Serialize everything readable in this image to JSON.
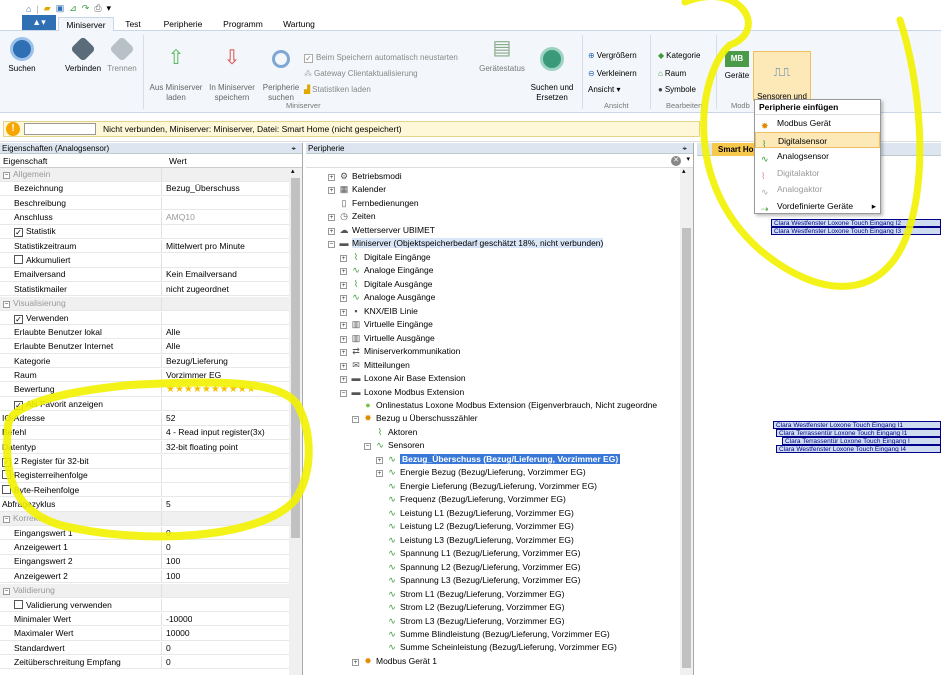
{
  "qat": {
    "icons": [
      "home-icon",
      "separator-icon",
      "folder-open-icon",
      "save-icon",
      "chart-icon",
      "redo-icon",
      "print-icon",
      "dropdown-icon"
    ]
  },
  "tabs": {
    "file": "▲▾",
    "items": [
      "Miniserver",
      "Test",
      "Peripherie",
      "Programm",
      "Wartung"
    ],
    "active": "Miniserver"
  },
  "ribbon": {
    "buttons": [
      {
        "label": "Suchen"
      },
      {
        "label": "Verbinden"
      },
      {
        "label": "Trennen"
      },
      {
        "label": "Aus Miniserver\nladen"
      },
      {
        "label": "In Miniserver\nspeichern"
      },
      {
        "label": "Peripherie\nsuchen"
      },
      {
        "label": "Gerätestatus"
      },
      {
        "label": "Suchen und\nErsetzen"
      },
      {
        "label": "Geräte"
      }
    ],
    "options": {
      "autostart": "Beim Speichern automatisch neustarten",
      "gateway": "Gateway Clientaktualisierung",
      "stats": "Statistiken laden"
    },
    "view": {
      "zoomin": "Vergrößern",
      "zoomout": "Verkleinern",
      "view": "Ansicht ▾",
      "category": "Kategorie",
      "room": "Raum",
      "symbols": "Symbole"
    },
    "groups": {
      "miniserver": "Miniserver",
      "ansicht": "Ansicht",
      "bearbeiten": "Bearbeiten",
      "modb": "Modb"
    },
    "mb_label": "MB",
    "sensors_button": "Sensoren und\nAktoren ▾"
  },
  "dropdown": {
    "title": "Peripherie einfügen",
    "items": [
      {
        "label": "Modbus Gerät",
        "dim": false
      },
      {
        "label": "Digitalsensor",
        "dim": false,
        "hl": true
      },
      {
        "label": "Analogsensor",
        "dim": false
      },
      {
        "label": "Digitalaktor",
        "dim": true
      },
      {
        "label": "Analogaktor",
        "dim": true
      },
      {
        "label": "Vordefinierte Geräte",
        "dim": false,
        "submenu": true
      }
    ]
  },
  "infobar": {
    "text": "Nicht verbunden, Miniserver: Miniserver, Datei: Smart Home (nicht gespeichert)"
  },
  "props": {
    "title": "Eigenschaften (Analogsensor)",
    "col_name": "Eigenschaft",
    "col_value": "Wert",
    "rows": [
      {
        "n": "Allgemein",
        "v": "",
        "cat": true
      },
      {
        "n": "Bezeichnung",
        "v": "Bezug_Überschuss"
      },
      {
        "n": "Beschreibung",
        "v": ""
      },
      {
        "n": "Anschluss",
        "v": "AMQ10",
        "dimv": true
      },
      {
        "n": "Statistik",
        "v": "",
        "cb": "checked"
      },
      {
        "n": "Statistikzeitraum",
        "v": "Mittelwert pro Minute"
      },
      {
        "n": "Akkumuliert",
        "v": "",
        "cb": "unchecked"
      },
      {
        "n": "Emailversand",
        "v": "Kein Emailversand"
      },
      {
        "n": "Statistikmailer",
        "v": "nicht zugeordnet"
      },
      {
        "n": "Visualisierung",
        "v": "",
        "cat": true
      },
      {
        "n": "Verwenden",
        "v": "",
        "cb": "checked"
      },
      {
        "n": "Erlaubte Benutzer lokal",
        "v": "Alle"
      },
      {
        "n": "Erlaubte Benutzer Internet",
        "v": "Alle"
      },
      {
        "n": "Kategorie",
        "v": "Bezug/Lieferung"
      },
      {
        "n": "Raum",
        "v": "Vorzimmer EG"
      },
      {
        "n": "Bewertung",
        "v": "★★★★★★★★★★",
        "stars": true
      },
      {
        "n": "Als Favorit anzeigen",
        "v": "",
        "cb": "checked"
      },
      {
        "n": "IO-Adresse",
        "v": "52",
        "flush": true
      },
      {
        "n": "Befehl",
        "v": "4 - Read input register(3x)",
        "flush": true
      },
      {
        "n": "Datentyp",
        "v": "32-bit floating point",
        "flush": true
      },
      {
        "n": "2 Register für 32-bit",
        "v": "",
        "cb": "checked",
        "flush": true
      },
      {
        "n": "Registerreihenfolge",
        "v": "",
        "cb": "unchecked",
        "flush": true
      },
      {
        "n": "Byte-Reihenfolge",
        "v": "",
        "cb": "unchecked",
        "flush": true
      },
      {
        "n": "Abfragezyklus",
        "v": "5",
        "flush": true
      },
      {
        "n": "Korrektur",
        "v": "",
        "cat": true
      },
      {
        "n": "Eingangswert 1",
        "v": "0"
      },
      {
        "n": "Anzeigewert 1",
        "v": "0"
      },
      {
        "n": "Eingangswert 2",
        "v": "100"
      },
      {
        "n": "Anzeigewert 2",
        "v": "100"
      },
      {
        "n": "Validierung",
        "v": "",
        "cat": true
      },
      {
        "n": "Validierung verwenden",
        "v": "",
        "cb": "unchecked"
      },
      {
        "n": "Minimaler Wert",
        "v": "-10000"
      },
      {
        "n": "Maximaler Wert",
        "v": "10000"
      },
      {
        "n": "Standardwert",
        "v": "0"
      },
      {
        "n": "Zeitüberschreitung Empfang",
        "v": "0"
      }
    ]
  },
  "peri": {
    "title": "Peripherie",
    "tree": [
      {
        "l": "Betriebsmodi",
        "d": 0,
        "e": "+",
        "i": "⚙"
      },
      {
        "l": "Kalender",
        "d": 0,
        "e": "+",
        "i": "▦"
      },
      {
        "l": "Fernbedienungen",
        "d": 0,
        "e": "",
        "i": "▯"
      },
      {
        "l": "Zeiten",
        "d": 0,
        "e": "+",
        "i": "◷"
      },
      {
        "l": "Wetterserver UBIMET",
        "d": 0,
        "e": "+",
        "i": "☁"
      },
      {
        "l": "Miniserver (Objektspeicherbedarf geschätzt 18%, nicht verbunden)",
        "d": 0,
        "e": "−",
        "i": "▬",
        "hl": true
      },
      {
        "l": "Digitale Eingänge",
        "d": 1,
        "e": "+",
        "i": "⌇"
      },
      {
        "l": "Analoge Eingänge",
        "d": 1,
        "e": "+",
        "i": "∿"
      },
      {
        "l": "Digitale Ausgänge",
        "d": 1,
        "e": "+",
        "i": "⌇"
      },
      {
        "l": "Analoge Ausgänge",
        "d": 1,
        "e": "+",
        "i": "∿"
      },
      {
        "l": "KNX/EIB Linie",
        "d": 1,
        "e": "+",
        "i": "▪"
      },
      {
        "l": "Virtuelle Eingänge",
        "d": 1,
        "e": "+",
        "i": "▥"
      },
      {
        "l": "Virtuelle Ausgänge",
        "d": 1,
        "e": "+",
        "i": "▥"
      },
      {
        "l": "Miniserverkommunikation",
        "d": 1,
        "e": "+",
        "i": "⇄"
      },
      {
        "l": "Mitteilungen",
        "d": 1,
        "e": "+",
        "i": "✉"
      },
      {
        "l": "Loxone Air Base Extension",
        "d": 1,
        "e": "+",
        "i": "▬"
      },
      {
        "l": "Loxone Modbus Extension",
        "d": 1,
        "e": "−",
        "i": "▬"
      },
      {
        "l": "Onlinestatus Loxone Modbus Extension (Eigenverbrauch, Nicht zugeordne",
        "d": 2,
        "e": "",
        "i": "●"
      },
      {
        "l": "Bezug u Überschusszähler",
        "d": 2,
        "e": "−",
        "i": "✸"
      },
      {
        "l": "Aktoren",
        "d": 3,
        "e": "",
        "i": "⌇"
      },
      {
        "l": "Sensoren",
        "d": 3,
        "e": "−",
        "i": "∿"
      },
      {
        "l": "Bezug_Überschuss (Bezug/Lieferung, Vorzimmer EG)",
        "d": 4,
        "e": "+",
        "i": "∿",
        "sel": true
      },
      {
        "l": "Energie Bezug (Bezug/Lieferung, Vorzimmer EG)",
        "d": 4,
        "e": "+",
        "i": "∿"
      },
      {
        "l": "Energie Lieferung (Bezug/Lieferung, Vorzimmer EG)",
        "d": 4,
        "e": "",
        "i": "∿"
      },
      {
        "l": "Frequenz (Bezug/Lieferung, Vorzimmer EG)",
        "d": 4,
        "e": "",
        "i": "∿"
      },
      {
        "l": "Leistung L1 (Bezug/Lieferung, Vorzimmer EG)",
        "d": 4,
        "e": "",
        "i": "∿"
      },
      {
        "l": "Leistung L2 (Bezug/Lieferung, Vorzimmer EG)",
        "d": 4,
        "e": "",
        "i": "∿"
      },
      {
        "l": "Leistung L3 (Bezug/Lieferung, Vorzimmer EG)",
        "d": 4,
        "e": "",
        "i": "∿"
      },
      {
        "l": "Spannung L1 (Bezug/Lieferung, Vorzimmer EG)",
        "d": 4,
        "e": "",
        "i": "∿"
      },
      {
        "l": "Spannung L2 (Bezug/Lieferung, Vorzimmer EG)",
        "d": 4,
        "e": "",
        "i": "∿"
      },
      {
        "l": "Spannung L3 (Bezug/Lieferung, Vorzimmer EG)",
        "d": 4,
        "e": "",
        "i": "∿"
      },
      {
        "l": "Strom L1 (Bezug/Lieferung, Vorzimmer EG)",
        "d": 4,
        "e": "",
        "i": "∿"
      },
      {
        "l": "Strom L2 (Bezug/Lieferung, Vorzimmer EG)",
        "d": 4,
        "e": "",
        "i": "∿"
      },
      {
        "l": "Strom L3 (Bezug/Lieferung, Vorzimmer EG)",
        "d": 4,
        "e": "",
        "i": "∿"
      },
      {
        "l": "Summe Blindleistung (Bezug/Lieferung, Vorzimmer EG)",
        "d": 4,
        "e": "",
        "i": "∿"
      },
      {
        "l": "Summe Scheinleistung (Bezug/Lieferung, Vorzimmer EG)",
        "d": 4,
        "e": "",
        "i": "∿"
      },
      {
        "l": "Modbus Gerät 1",
        "d": 2,
        "e": "+",
        "i": "✸"
      }
    ]
  },
  "canvas": {
    "tab": "Smart Home",
    "blocks_top": [
      "Clara Westfenster Loxone Touch Eingang I2",
      "Clara Westfenster Loxone Touch Eingang I3"
    ],
    "blocks_mid": [
      "Clara Westfenster Loxone Touch Eingang I1",
      "Clara Terrassentür Loxone Touch Eingang I1",
      "Clara Terrassentür Loxone Touch Eingang I",
      "Clara Westfenster Loxone Touch Eingang I4"
    ]
  },
  "colors": {
    "accent": "#2f6fb4",
    "highlight_stroke": "#f2f200",
    "selection": "#3a78d8",
    "warning": "#f7a500"
  }
}
